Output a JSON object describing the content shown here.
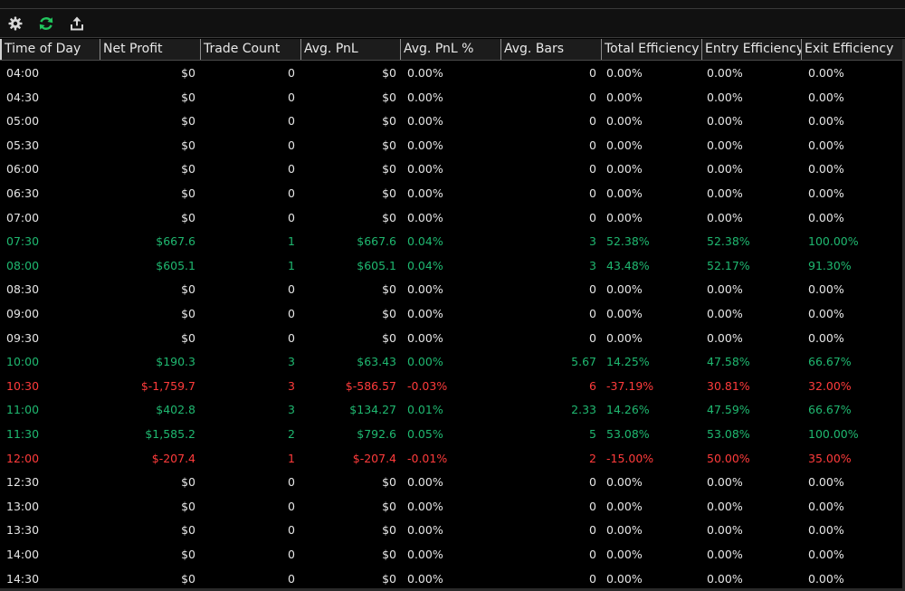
{
  "colors": {
    "neutral": "#e6e6e6",
    "positive": "#1fb870",
    "negative": "#ff3b3b",
    "refresh": "#22c55e"
  },
  "toolbar": {
    "icons": [
      "gear-icon",
      "refresh-icon",
      "export-icon"
    ]
  },
  "columns": [
    "Time of Day",
    "Net Profit",
    "Trade Count",
    "Avg. PnL",
    "Avg. PnL %",
    "Avg. Bars",
    "Total Efficiency",
    "Entry Efficiency",
    "Exit Efficiency"
  ],
  "rows": [
    {
      "status": "neutral",
      "cells": [
        "04:00",
        "$0",
        "0",
        "$0",
        "0.00%",
        "0",
        "0.00%",
        "0.00%",
        "0.00%"
      ]
    },
    {
      "status": "neutral",
      "cells": [
        "04:30",
        "$0",
        "0",
        "$0",
        "0.00%",
        "0",
        "0.00%",
        "0.00%",
        "0.00%"
      ]
    },
    {
      "status": "neutral",
      "cells": [
        "05:00",
        "$0",
        "0",
        "$0",
        "0.00%",
        "0",
        "0.00%",
        "0.00%",
        "0.00%"
      ]
    },
    {
      "status": "neutral",
      "cells": [
        "05:30",
        "$0",
        "0",
        "$0",
        "0.00%",
        "0",
        "0.00%",
        "0.00%",
        "0.00%"
      ]
    },
    {
      "status": "neutral",
      "cells": [
        "06:00",
        "$0",
        "0",
        "$0",
        "0.00%",
        "0",
        "0.00%",
        "0.00%",
        "0.00%"
      ]
    },
    {
      "status": "neutral",
      "cells": [
        "06:30",
        "$0",
        "0",
        "$0",
        "0.00%",
        "0",
        "0.00%",
        "0.00%",
        "0.00%"
      ]
    },
    {
      "status": "neutral",
      "cells": [
        "07:00",
        "$0",
        "0",
        "$0",
        "0.00%",
        "0",
        "0.00%",
        "0.00%",
        "0.00%"
      ]
    },
    {
      "status": "positive",
      "cells": [
        "07:30",
        "$667.6",
        "1",
        "$667.6",
        "0.04%",
        "3",
        "52.38%",
        "52.38%",
        "100.00%"
      ]
    },
    {
      "status": "positive",
      "cells": [
        "08:00",
        "$605.1",
        "1",
        "$605.1",
        "0.04%",
        "3",
        "43.48%",
        "52.17%",
        "91.30%"
      ]
    },
    {
      "status": "neutral",
      "cells": [
        "08:30",
        "$0",
        "0",
        "$0",
        "0.00%",
        "0",
        "0.00%",
        "0.00%",
        "0.00%"
      ]
    },
    {
      "status": "neutral",
      "cells": [
        "09:00",
        "$0",
        "0",
        "$0",
        "0.00%",
        "0",
        "0.00%",
        "0.00%",
        "0.00%"
      ]
    },
    {
      "status": "neutral",
      "cells": [
        "09:30",
        "$0",
        "0",
        "$0",
        "0.00%",
        "0",
        "0.00%",
        "0.00%",
        "0.00%"
      ]
    },
    {
      "status": "positive",
      "cells": [
        "10:00",
        "$190.3",
        "3",
        "$63.43",
        "0.00%",
        "5.67",
        "14.25%",
        "47.58%",
        "66.67%"
      ]
    },
    {
      "status": "negative",
      "cells": [
        "10:30",
        "$-1,759.7",
        "3",
        "$-586.57",
        "-0.03%",
        "6",
        "-37.19%",
        "30.81%",
        "32.00%"
      ]
    },
    {
      "status": "positive",
      "cells": [
        "11:00",
        "$402.8",
        "3",
        "$134.27",
        "0.01%",
        "2.33",
        "14.26%",
        "47.59%",
        "66.67%"
      ]
    },
    {
      "status": "positive",
      "cells": [
        "11:30",
        "$1,585.2",
        "2",
        "$792.6",
        "0.05%",
        "5",
        "53.08%",
        "53.08%",
        "100.00%"
      ]
    },
    {
      "status": "negative",
      "cells": [
        "12:00",
        "$-207.4",
        "1",
        "$-207.4",
        "-0.01%",
        "2",
        "-15.00%",
        "50.00%",
        "35.00%"
      ]
    },
    {
      "status": "neutral",
      "cells": [
        "12:30",
        "$0",
        "0",
        "$0",
        "0.00%",
        "0",
        "0.00%",
        "0.00%",
        "0.00%"
      ]
    },
    {
      "status": "neutral",
      "cells": [
        "13:00",
        "$0",
        "0",
        "$0",
        "0.00%",
        "0",
        "0.00%",
        "0.00%",
        "0.00%"
      ]
    },
    {
      "status": "neutral",
      "cells": [
        "13:30",
        "$0",
        "0",
        "$0",
        "0.00%",
        "0",
        "0.00%",
        "0.00%",
        "0.00%"
      ]
    },
    {
      "status": "neutral",
      "cells": [
        "14:00",
        "$0",
        "0",
        "$0",
        "0.00%",
        "0",
        "0.00%",
        "0.00%",
        "0.00%"
      ]
    },
    {
      "status": "neutral",
      "cells": [
        "14:30",
        "$0",
        "0",
        "$0",
        "0.00%",
        "0",
        "0.00%",
        "0.00%",
        "0.00%"
      ]
    }
  ]
}
